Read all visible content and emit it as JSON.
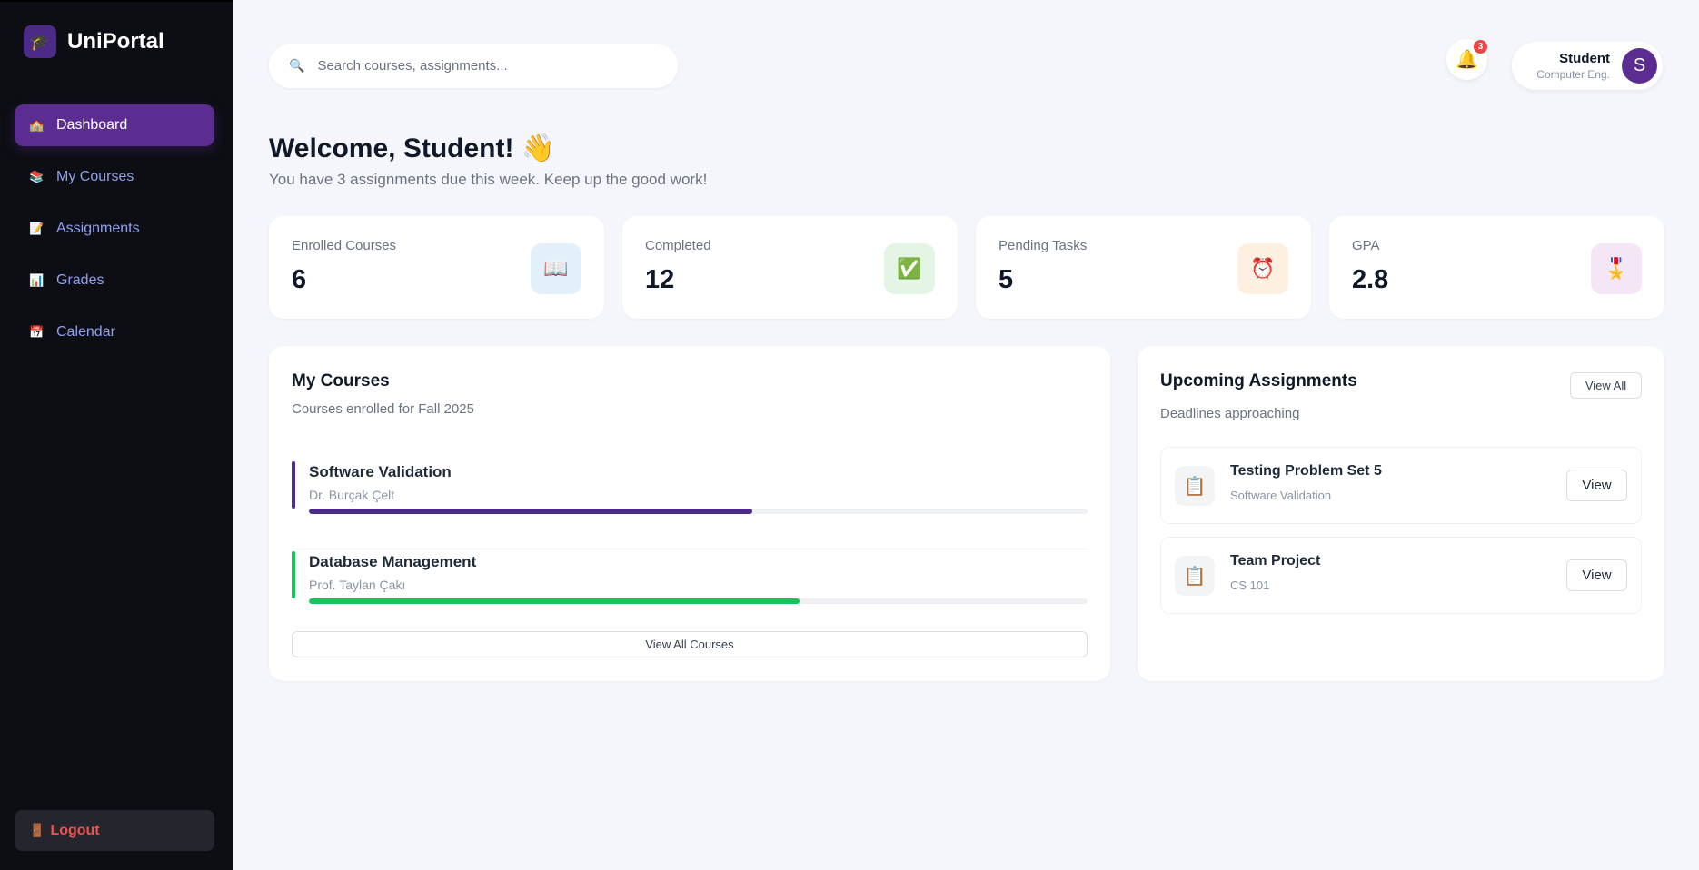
{
  "app": {
    "name": "UniPortal",
    "logo_icon": "graduation-cap-icon",
    "logo_glyph": "🎓"
  },
  "sidebar": {
    "items": [
      {
        "label": "Dashboard",
        "icon": "house-icon",
        "glyph": "🏫",
        "active": true
      },
      {
        "label": "My Courses",
        "icon": "books-icon",
        "glyph": "📚",
        "active": false
      },
      {
        "label": "Assignments",
        "icon": "document-icon",
        "glyph": "📝",
        "active": false
      },
      {
        "label": "Grades",
        "icon": "bar-chart-icon",
        "glyph": "📊",
        "active": false
      },
      {
        "label": "Calendar",
        "icon": "calendar-icon",
        "glyph": "📅",
        "active": false
      }
    ],
    "logout": {
      "label": "Logout",
      "icon": "door-icon",
      "glyph": "🚪"
    }
  },
  "search": {
    "placeholder": "Search courses, assignments...",
    "value": "",
    "glyph": "🔍"
  },
  "notifications": {
    "count": "3",
    "glyph": "🔔"
  },
  "user": {
    "name": "Student",
    "role": "Computer Eng.",
    "initial": "S"
  },
  "welcome": {
    "title": "Welcome, Student! 👋",
    "subtitle": "You have 3 assignments due this week. Keep up the good work!"
  },
  "stats": [
    {
      "label": "Enrolled Courses",
      "value": "6",
      "icon": "open-book-icon",
      "glyph": "📖",
      "bg": "#e3f0fb"
    },
    {
      "label": "Completed",
      "value": "12",
      "icon": "check-mark-icon",
      "glyph": "✅",
      "bg": "#e4f5e6"
    },
    {
      "label": "Pending Tasks",
      "value": "5",
      "icon": "alarm-clock-icon",
      "glyph": "⏰",
      "bg": "#fdf0e0"
    },
    {
      "label": "GPA",
      "value": "2.8",
      "icon": "medal-icon",
      "glyph": "🎖️",
      "bg": "#f5e6f5"
    }
  ],
  "courses_card": {
    "title": "My Courses",
    "subtitle": "Courses enrolled for Fall 2025",
    "courses": [
      {
        "title": "Software Validation",
        "instructor": "Dr. Burçak Çelt",
        "progress": 0.57,
        "color": "#4c2a87"
      },
      {
        "title": "Database Management",
        "instructor": "Prof. Taylan Çakı",
        "progress": 0.63,
        "color": "#16c55a"
      }
    ],
    "view_all_label": "View All Courses"
  },
  "assignments_card": {
    "title": "Upcoming Assignments",
    "subtitle": "Deadlines approaching",
    "view_all_label": "View All",
    "items": [
      {
        "title": "Testing Problem Set 5",
        "course": "Software Validation",
        "button": "View",
        "icon": "clipboard-icon",
        "glyph": "📋"
      },
      {
        "title": "Team Project",
        "course": "CS 101",
        "button": "View",
        "icon": "clipboard-icon",
        "glyph": "📋"
      }
    ]
  }
}
